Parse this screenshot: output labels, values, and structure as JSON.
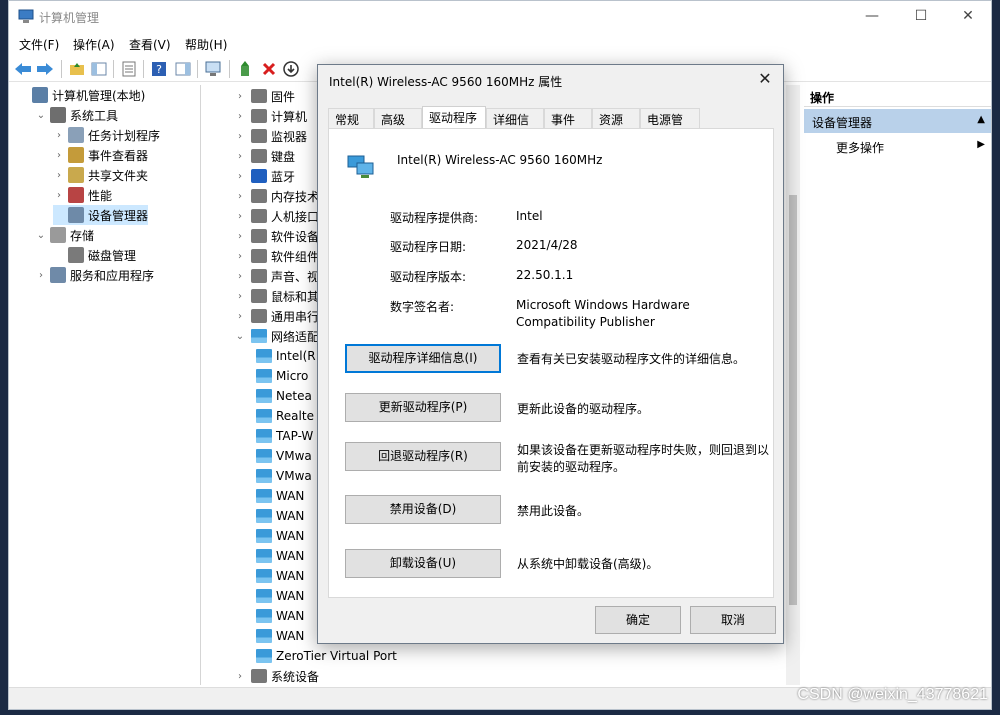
{
  "window": {
    "title": "计算机管理",
    "min_glyph": "—",
    "max_glyph": "☐",
    "close_glyph": "✕"
  },
  "menu": [
    "文件(F)",
    "操作(A)",
    "查看(V)",
    "帮助(H)"
  ],
  "left_tree": [
    {
      "label": "计算机管理(本地)",
      "icon": "computer-management-icon",
      "indent": 0,
      "chev": "",
      "selected": false
    },
    {
      "label": "系统工具",
      "icon": "tools-icon",
      "indent": 1,
      "chev": "⌄",
      "selected": false
    },
    {
      "label": "任务计划程序",
      "icon": "clock-icon",
      "indent": 2,
      "chev": "›",
      "selected": false
    },
    {
      "label": "事件查看器",
      "icon": "event-viewer-icon",
      "indent": 2,
      "chev": "›",
      "selected": false
    },
    {
      "label": "共享文件夹",
      "icon": "shared-folder-icon",
      "indent": 2,
      "chev": "›",
      "selected": false
    },
    {
      "label": "性能",
      "icon": "performance-icon",
      "indent": 2,
      "chev": "›",
      "selected": false
    },
    {
      "label": "设备管理器",
      "icon": "device-manager-icon",
      "indent": 2,
      "chev": "",
      "selected": true
    },
    {
      "label": "存储",
      "icon": "storage-icon",
      "indent": 1,
      "chev": "⌄",
      "selected": false
    },
    {
      "label": "磁盘管理",
      "icon": "disk-icon",
      "indent": 2,
      "chev": "",
      "selected": false
    },
    {
      "label": "服务和应用程序",
      "icon": "services-icon",
      "indent": 1,
      "chev": "›",
      "selected": false
    }
  ],
  "device_tree": [
    {
      "label": "固件",
      "icon": "firmware-icon",
      "indent": 0,
      "chev": "›"
    },
    {
      "label": "计算机",
      "icon": "computer-icon",
      "indent": 0,
      "chev": "›"
    },
    {
      "label": "监视器",
      "icon": "monitor-icon",
      "indent": 0,
      "chev": "›"
    },
    {
      "label": "键盘",
      "icon": "keyboard-icon",
      "indent": 0,
      "chev": "›"
    },
    {
      "label": "蓝牙",
      "icon": "bluetooth-icon",
      "indent": 0,
      "chev": "›"
    },
    {
      "label": "内存技术设",
      "icon": "memory-icon",
      "indent": 0,
      "chev": "›"
    },
    {
      "label": "人机接口设",
      "icon": "hid-icon",
      "indent": 0,
      "chev": "›"
    },
    {
      "label": "软件设备",
      "icon": "software-device-icon",
      "indent": 0,
      "chev": "›"
    },
    {
      "label": "软件组件",
      "icon": "software-component-icon",
      "indent": 0,
      "chev": "›"
    },
    {
      "label": "声音、视频",
      "icon": "sound-icon",
      "indent": 0,
      "chev": "›"
    },
    {
      "label": "鼠标和其他",
      "icon": "mouse-icon",
      "indent": 0,
      "chev": "›"
    },
    {
      "label": "通用串行总",
      "icon": "usb-icon",
      "indent": 0,
      "chev": "›"
    },
    {
      "label": "网络适配器",
      "icon": "network-adapter-icon",
      "indent": 0,
      "chev": "⌄"
    },
    {
      "label": "Intel(R",
      "icon": "network-adapter-icon",
      "indent": 1,
      "chev": ""
    },
    {
      "label": "Micro",
      "icon": "network-adapter-icon",
      "indent": 1,
      "chev": ""
    },
    {
      "label": "Netea",
      "icon": "network-adapter-icon",
      "indent": 1,
      "chev": ""
    },
    {
      "label": "Realte",
      "icon": "network-adapter-icon",
      "indent": 1,
      "chev": ""
    },
    {
      "label": "TAP-W",
      "icon": "network-adapter-icon",
      "indent": 1,
      "chev": ""
    },
    {
      "label": "VMwa",
      "icon": "network-adapter-icon",
      "indent": 1,
      "chev": ""
    },
    {
      "label": "VMwa",
      "icon": "network-adapter-icon",
      "indent": 1,
      "chev": ""
    },
    {
      "label": "WAN",
      "icon": "network-adapter-icon",
      "indent": 1,
      "chev": ""
    },
    {
      "label": "WAN",
      "icon": "network-adapter-icon",
      "indent": 1,
      "chev": ""
    },
    {
      "label": "WAN",
      "icon": "network-adapter-icon",
      "indent": 1,
      "chev": ""
    },
    {
      "label": "WAN",
      "icon": "network-adapter-icon",
      "indent": 1,
      "chev": ""
    },
    {
      "label": "WAN",
      "icon": "network-adapter-icon",
      "indent": 1,
      "chev": ""
    },
    {
      "label": "WAN",
      "icon": "network-adapter-icon",
      "indent": 1,
      "chev": ""
    },
    {
      "label": "WAN",
      "icon": "network-adapter-icon",
      "indent": 1,
      "chev": ""
    },
    {
      "label": "WAN",
      "icon": "network-adapter-icon",
      "indent": 1,
      "chev": ""
    },
    {
      "label": "ZeroTier Virtual Port",
      "icon": "network-adapter-icon",
      "indent": 1,
      "chev": ""
    },
    {
      "label": "系统设备",
      "icon": "system-device-icon",
      "indent": 0,
      "chev": "›"
    }
  ],
  "actions": {
    "header": "操作",
    "section": "设备管理器",
    "more": "更多操作"
  },
  "dialog": {
    "title": "Intel(R) Wireless-AC 9560 160MHz 属性",
    "close_glyph": "✕",
    "tabs": [
      "常规",
      "高级",
      "驱动程序",
      "详细信息",
      "事件",
      "资源",
      "电源管理"
    ],
    "active_tab": 2,
    "device_name": "Intel(R) Wireless-AC 9560 160MHz",
    "properties": [
      {
        "label": "驱动程序提供商:",
        "value": "Intel"
      },
      {
        "label": "驱动程序日期:",
        "value": "2021/4/28"
      },
      {
        "label": "驱动程序版本:",
        "value": "22.50.1.1"
      },
      {
        "label": "数字签名者:",
        "value": "Microsoft Windows Hardware Compatibility Publisher"
      }
    ],
    "buttons": [
      {
        "label": "驱动程序详细信息(I)",
        "desc": "查看有关已安装驱动程序文件的详细信息。",
        "name": "driver-details-button"
      },
      {
        "label": "更新驱动程序(P)",
        "desc": "更新此设备的驱动程序。",
        "name": "update-driver-button"
      },
      {
        "label": "回退驱动程序(R)",
        "desc": "如果该设备在更新驱动程序时失败，则回退到以前安装的驱动程序。",
        "name": "rollback-driver-button"
      },
      {
        "label": "禁用设备(D)",
        "desc": "禁用此设备。",
        "name": "disable-device-button"
      },
      {
        "label": "卸载设备(U)",
        "desc": "从系统中卸载设备(高级)。",
        "name": "uninstall-device-button"
      }
    ],
    "ok": "确定",
    "cancel": "取消"
  },
  "watermark": "CSDN @weixin_43778621",
  "colors": {
    "selection": "#cce8ff",
    "action_section": "#b9d1ea",
    "focus_border": "#0078d7"
  }
}
